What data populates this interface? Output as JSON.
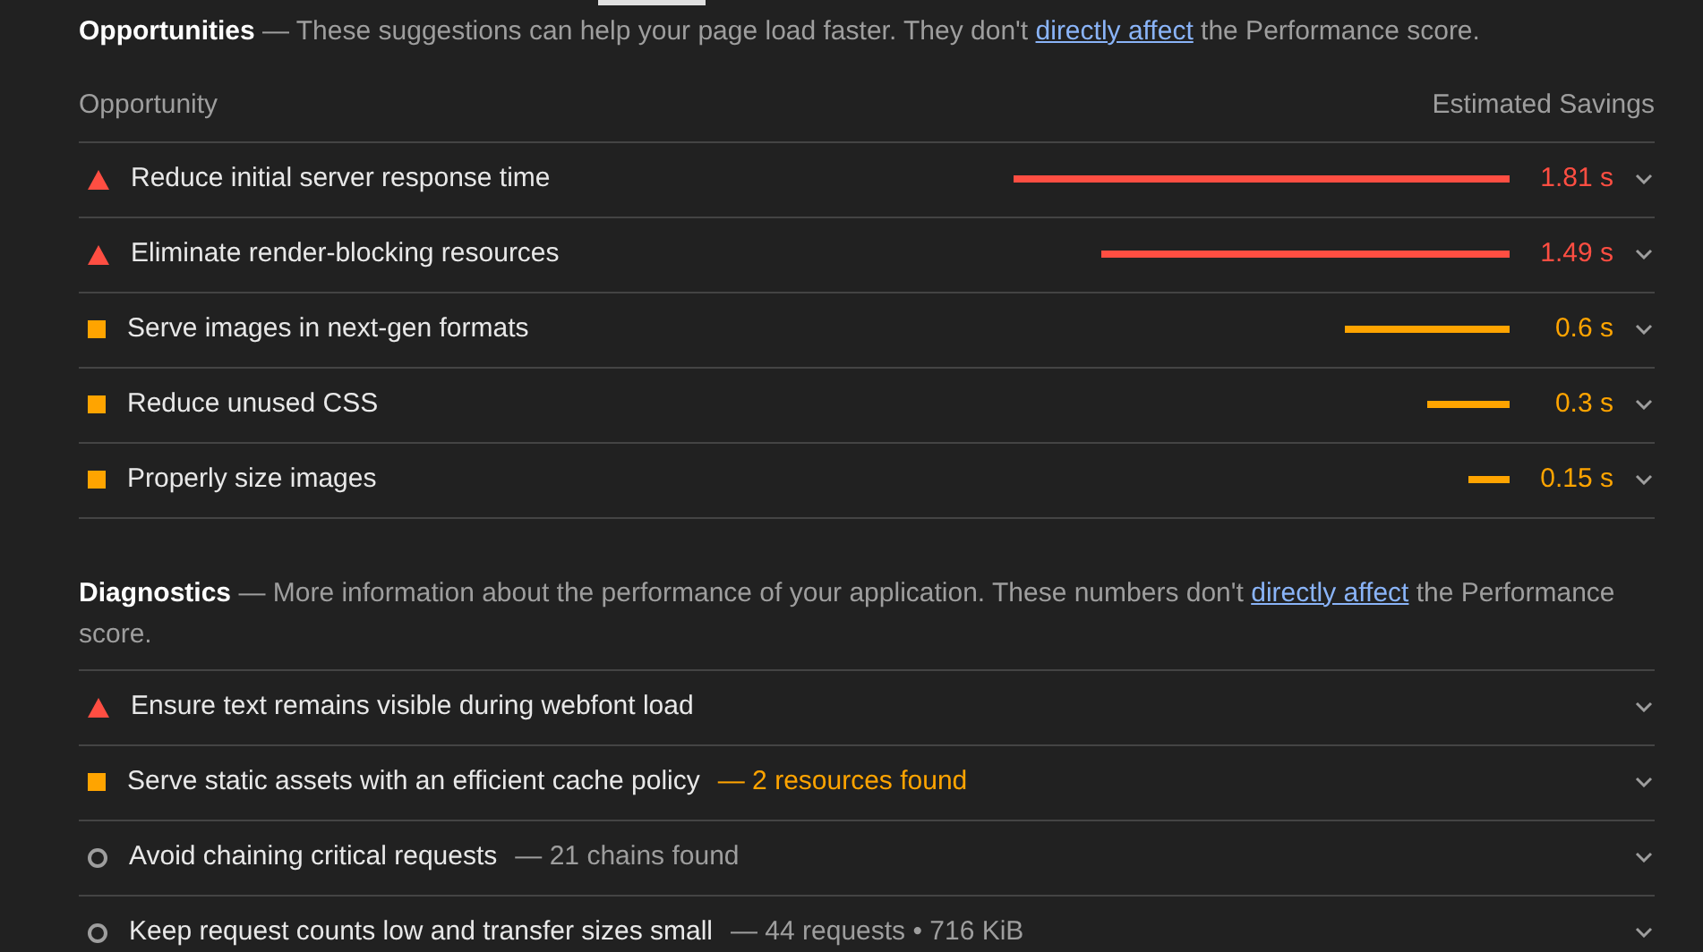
{
  "opportunities": {
    "title": "Opportunities",
    "description": "— These suggestions can help your page load faster. They don't ",
    "link": "directly affect",
    "description_end": " the Performance score.",
    "column_left": "Opportunity",
    "column_right": "Estimated Savings",
    "items": [
      {
        "kind": "fail",
        "title": "Reduce initial server response time",
        "savings": "1.81 s"
      },
      {
        "kind": "fail",
        "title": "Eliminate render-blocking resources",
        "savings": "1.49 s"
      },
      {
        "kind": "average",
        "title": "Serve images in next-gen formats",
        "savings": "0.6 s"
      },
      {
        "kind": "average",
        "title": "Reduce unused CSS",
        "savings": "0.3 s"
      },
      {
        "kind": "average",
        "title": "Properly size images",
        "savings": "0.15 s"
      }
    ]
  },
  "diagnostics": {
    "title": "Diagnostics",
    "description": "— More information about the performance of your application. These numbers don't ",
    "link": "directly affect",
    "description_end": " the Performance score.",
    "items": [
      {
        "kind": "fail",
        "title": "Ensure text remains visible during webfont load"
      },
      {
        "kind": "average",
        "title": "Serve static assets with an efficient cache policy",
        "detail": "— 2 resources found"
      },
      {
        "kind": "info",
        "title": "Avoid chaining critical requests",
        "detail": "— 21 chains found"
      },
      {
        "kind": "info",
        "title": "Keep request counts low and transfer sizes small",
        "detail": "— 44 requests • 716 KiB"
      }
    ]
  }
}
